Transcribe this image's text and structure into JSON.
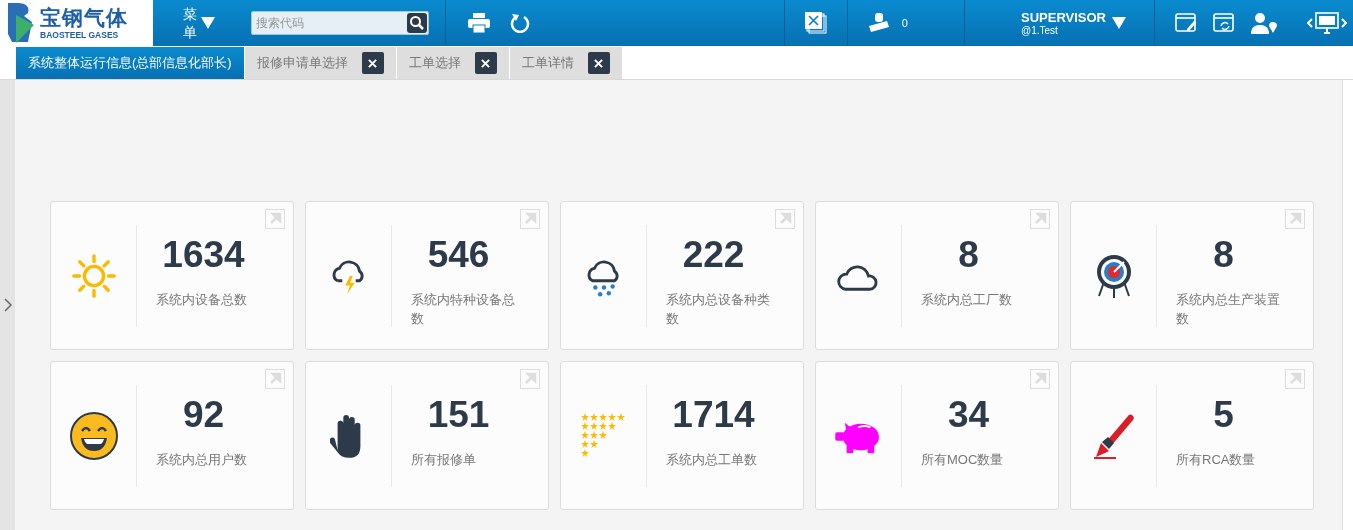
{
  "logo": {
    "name": "宝钢气体",
    "subtitle": "BAOSTEEL GASES"
  },
  "menu_button": {
    "label": "菜单"
  },
  "search": {
    "placeholder": "搜索代码"
  },
  "stamp_count": "0",
  "user": {
    "name": "SUPERVISOR",
    "account": "@1.Test"
  },
  "tabs": [
    {
      "label": "系统整体运行信息(总部信息化部长)",
      "selected": true,
      "closable": false
    },
    {
      "label": "报修申请单选择",
      "selected": false,
      "closable": true
    },
    {
      "label": "工单选择",
      "selected": false,
      "closable": true
    },
    {
      "label": "工单详情",
      "selected": false,
      "closable": true
    }
  ],
  "cards": [
    {
      "kind": "sun",
      "value": "1634",
      "label": "系统内设备总数",
      "link": true
    },
    {
      "kind": "storm",
      "value": "546",
      "label": "系统内特种设备总数",
      "link": true
    },
    {
      "kind": "rain",
      "value": "222",
      "label": "系统内总设备种类数",
      "link": true
    },
    {
      "kind": "cloud",
      "value": "8",
      "label": "系统内总工厂数",
      "link": true
    },
    {
      "kind": "target",
      "value": "8",
      "label": "系统内总生产装置数",
      "link": true
    },
    {
      "kind": "smile",
      "value": "92",
      "label": "系统内总用户数",
      "link": true
    },
    {
      "kind": "hand",
      "value": "151",
      "label": "所有报修单",
      "link": true
    },
    {
      "kind": "stars",
      "value": "1714",
      "label": "系统内总工单数",
      "link": false
    },
    {
      "kind": "piggy",
      "value": "34",
      "label": "所有MOC数量",
      "link": true
    },
    {
      "kind": "marker",
      "value": "5",
      "label": "所有RCA数量",
      "link": true
    }
  ]
}
